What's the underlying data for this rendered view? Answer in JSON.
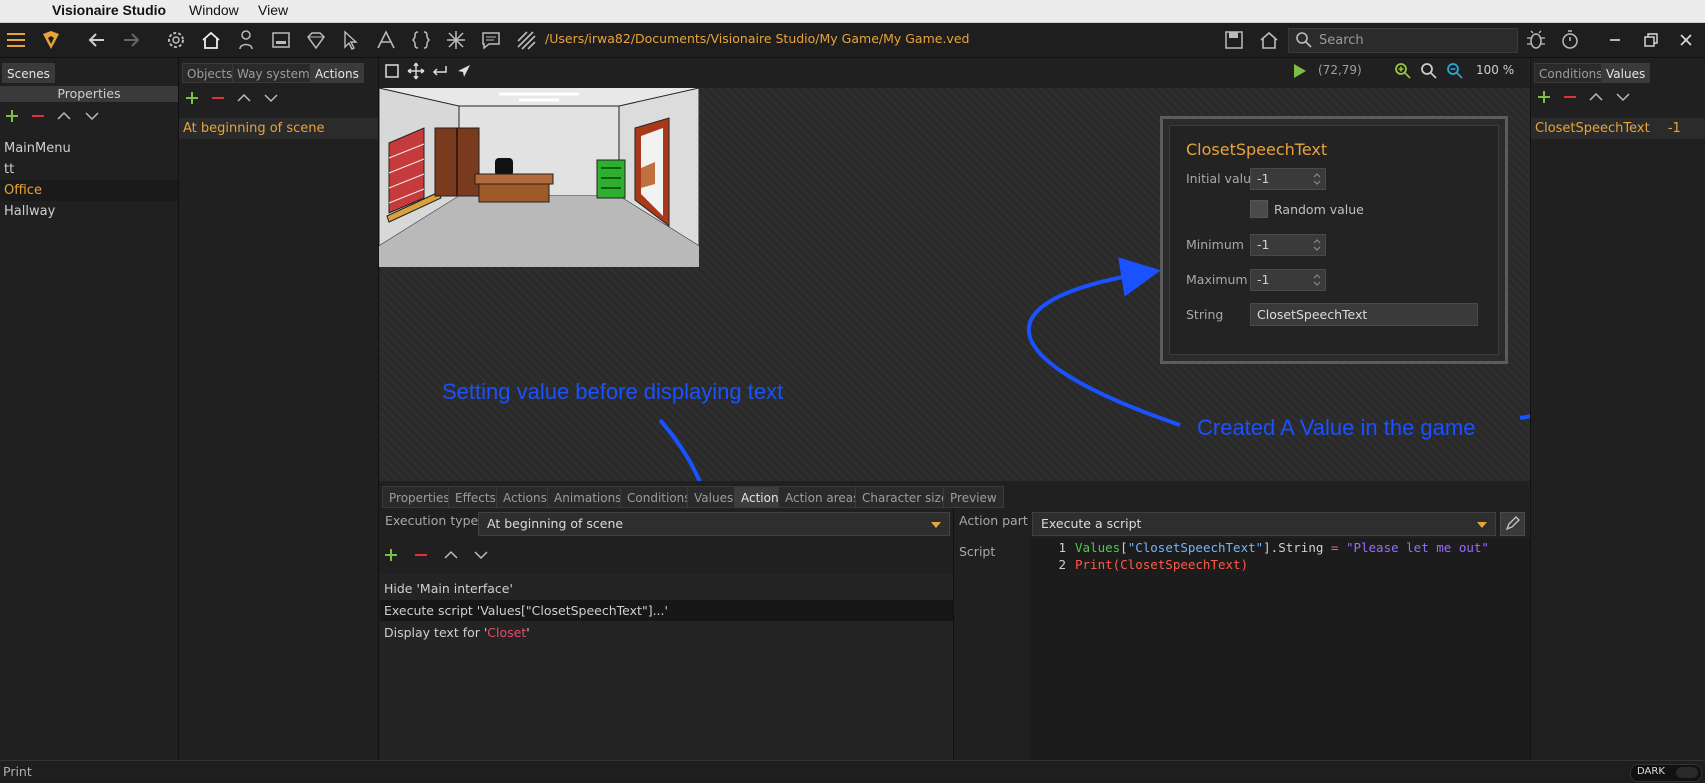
{
  "menubar": {
    "app": "Visionaire Studio",
    "items": [
      "Window",
      "View"
    ]
  },
  "toolbar": {
    "project_path": "/Users/irwa82/Documents/Visionaire Studio/My Game/My Game.ved",
    "search_placeholder": "Search"
  },
  "left_panel": {
    "tab": "Scenes",
    "header": "Properties",
    "scenes": [
      "MainMenu",
      "tt",
      "Office",
      "Hallway"
    ],
    "selected": "Office"
  },
  "middle_panel": {
    "tabs": [
      "Objects",
      "Way systems",
      "Actions"
    ],
    "active_tab": "Actions",
    "items": [
      "At beginning of scene"
    ]
  },
  "viewport": {
    "coords": "(72,79)",
    "zoom": "100 %"
  },
  "value_editor": {
    "title": "ClosetSpeechText",
    "initial_value_label": "Initial value",
    "initial_value": "-1",
    "random_label": "Random value",
    "minimum_label": "Minimum",
    "minimum": "-1",
    "maximum_label": "Maximum",
    "maximum": "-1",
    "string_label": "String",
    "string": "ClosetSpeechText"
  },
  "annotations": {
    "left": "Setting value before displaying text",
    "right": "Created A Value in the game"
  },
  "right_panel": {
    "tabs": [
      "Conditions",
      "Values"
    ],
    "active_tab": "Values",
    "items": [
      {
        "name": "ClosetSpeechText",
        "value": "-1"
      }
    ]
  },
  "bottom_tabs": [
    "Properties",
    "Effects",
    "Actions",
    "Animations",
    "Conditions",
    "Values",
    "Action",
    "Action areas",
    "Character size",
    "Preview"
  ],
  "bottom_active_tab": "Action",
  "execution": {
    "label": "Execution type",
    "value": "At beginning of scene"
  },
  "action_list": [
    {
      "prefix": "Hide 'Main interface'",
      "highlight": ""
    },
    {
      "prefix": "Execute script 'Values[\"ClosetSpeechText\"]...'",
      "highlight": ""
    },
    {
      "prefix": "Display text for '",
      "highlight": "Closet",
      "suffix": "'"
    }
  ],
  "action_part": {
    "label": "Action part",
    "value": "Execute a script",
    "script_label": "Script"
  },
  "script": {
    "line_numbers": [
      "1",
      "2"
    ],
    "line1": {
      "a": "Values",
      "b": "[",
      "c": "\"ClosetSpeechText\"",
      "d": "].",
      "e": "String",
      "f": " = ",
      "g": "\"Please let me out\""
    },
    "line2": {
      "a": "Print(ClosetSpeechText)"
    }
  },
  "status": {
    "text": "Print",
    "theme": "DARK"
  },
  "colors": {
    "accent": "#e8a33c",
    "annotation": "#1a52ff",
    "background": "#262626"
  }
}
